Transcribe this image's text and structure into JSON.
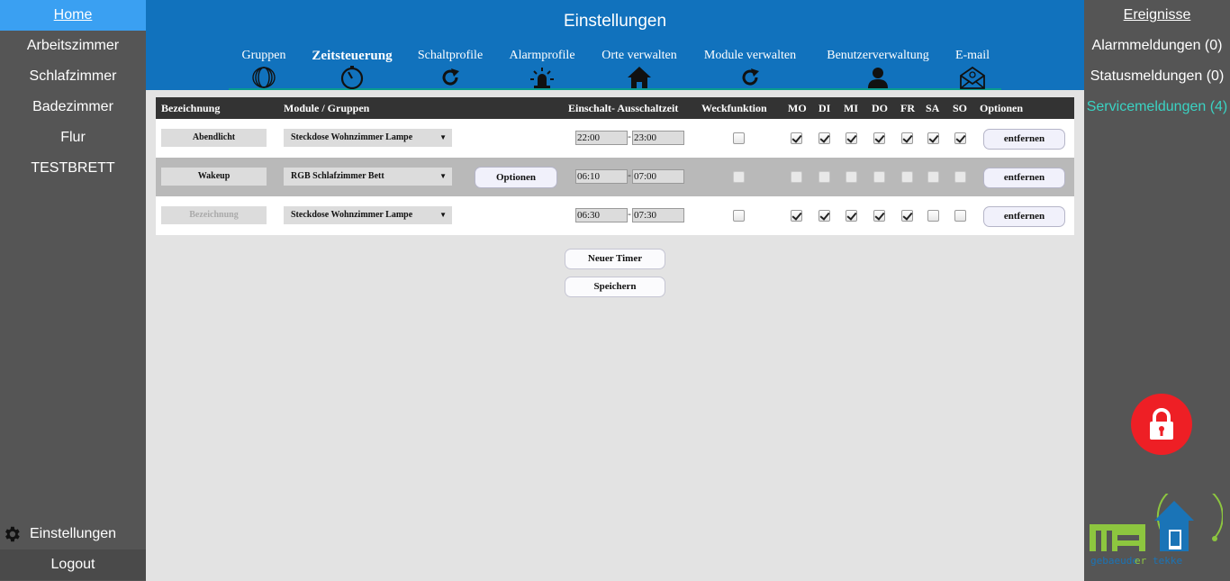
{
  "left_nav": {
    "items": [
      {
        "label": "Home",
        "active": true
      },
      {
        "label": "Arbeitszimmer"
      },
      {
        "label": "Schlafzimmer"
      },
      {
        "label": "Badezimmer"
      },
      {
        "label": "Flur"
      },
      {
        "label": "TESTBRETT"
      }
    ],
    "settings_label": "Einstellungen",
    "settings_icon": "gear-icon",
    "logout_label": "Logout"
  },
  "header": {
    "title": "Einstellungen",
    "tabs": [
      {
        "label": "Gruppen",
        "icon": "rings-icon"
      },
      {
        "label": "Zeitsteuerung",
        "icon": "timer-icon",
        "active": true
      },
      {
        "label": "Schaltprofile",
        "icon": "refresh-icon"
      },
      {
        "label": "Alarmprofile",
        "icon": "siren-icon"
      },
      {
        "label": "Orte verwalten",
        "icon": "house-icon"
      },
      {
        "label": "Module verwalten",
        "icon": "refresh-icon"
      },
      {
        "label": "Benutzerverwaltung",
        "icon": "user-icon"
      },
      {
        "label": "E-mail",
        "icon": "envelope-icon"
      }
    ]
  },
  "table": {
    "headers": {
      "name": "Bezeichnung",
      "module": "Module / Gruppen",
      "time": "Einschalt- Ausschaltzeit",
      "wake": "Weckfunktion",
      "days": [
        "MO",
        "DI",
        "MI",
        "DO",
        "FR",
        "SA",
        "SO"
      ],
      "options": "Optionen"
    },
    "rows": [
      {
        "name": "Abendlicht",
        "module": "Steckdose Wohnzimmer Lampe",
        "on_time": "22:00",
        "off_time": "23:00",
        "wake": false,
        "days": [
          true,
          true,
          true,
          true,
          true,
          true,
          true
        ],
        "remove_label": "entfernen"
      },
      {
        "name": "Wakeup",
        "module": "RGB Schlafzimmer Bett",
        "options_label": "Optionen",
        "on_time": "06:10",
        "off_time": "07:00",
        "wake": false,
        "days": [
          false,
          false,
          false,
          false,
          false,
          false,
          false
        ],
        "remove_label": "entfernen"
      },
      {
        "name": "Bezeichnung",
        "placeholder": true,
        "module": "Steckdose Wohnzimmer Lampe",
        "on_time": "06:30",
        "off_time": "07:30",
        "wake": false,
        "days": [
          true,
          true,
          true,
          true,
          true,
          false,
          false
        ],
        "remove_label": "entfernen"
      }
    ]
  },
  "actions": {
    "new_timer": "Neuer Timer",
    "save": "Speichern"
  },
  "right_panel": {
    "title": "Ereignisse",
    "alarm": "Alarmmeldungen (0)",
    "status": "Statusmeldungen (0)",
    "service": "Servicemeldungen (4)",
    "service_color": "#3ad3c3",
    "lock_color": "#ee1f25",
    "lock_icon": "lock-icon"
  },
  "colors": {
    "header_blue": "#1172bd",
    "sidebar": "#555555",
    "active_nav": "#3aa0f2"
  }
}
